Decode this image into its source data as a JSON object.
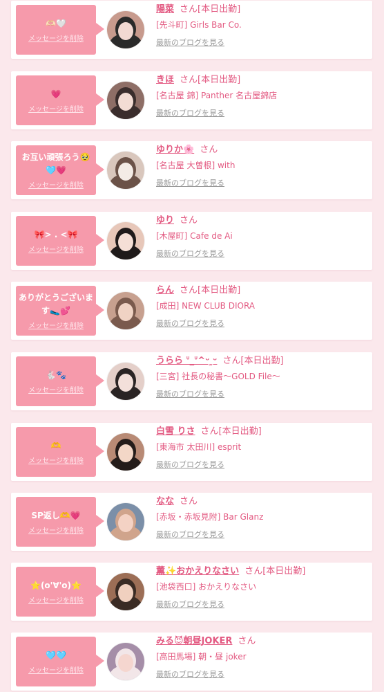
{
  "delete_label": "メッセージを削除",
  "honorific": "さん",
  "blog_label": "最新のブログを見る",
  "badge_label": "[本日出勤]",
  "cards": [
    {
      "message": "🫶🏻🤍",
      "name": "陽菜",
      "on_duty": true,
      "shop": "[先斗町] Girls Bar Co.",
      "avatar_palette": [
        "#2a2a2a",
        "#f2d9d2",
        "#c79a8d"
      ]
    },
    {
      "message": "💗",
      "name": "きほ",
      "on_duty": true,
      "shop": "[名古屋 錦] Panther 名古屋錦店",
      "avatar_palette": [
        "#3a2d2c",
        "#f3dcd4",
        "#8e6e66"
      ]
    },
    {
      "message": "お互い頑張ろう🥹🩵💗",
      "name": "ゆりか🌸",
      "on_duty": false,
      "shop": "[名古屋 大曽根] with",
      "avatar_palette": [
        "#6b5248",
        "#f4ece6",
        "#d9c7bd"
      ]
    },
    {
      "message": "🎀> . <🎀",
      "name": "ゆり",
      "on_duty": false,
      "shop": "[木屋町] Cafe de Ai",
      "avatar_palette": [
        "#1f1a1a",
        "#f5dfd6",
        "#e7c7b9"
      ]
    },
    {
      "message": "ありがとうございます🥿💕",
      "name": "らん",
      "on_duty": true,
      "shop": "[成田] NEW CLUB DIORA",
      "avatar_palette": [
        "#7a5a4d",
        "#f0d3c4",
        "#c7a08f"
      ]
    },
    {
      "message": "🐇🐾",
      "name": "うらら ᐡ_ᐡ^ᵕ ̫ᵕ",
      "on_duty": true,
      "shop": "[三宮] 社長の秘書〜GOLD File〜",
      "avatar_palette": [
        "#2a2424",
        "#f3e0da",
        "#e4cfc9"
      ]
    },
    {
      "message": "🫶",
      "name": "白雪 りさ",
      "on_duty": true,
      "shop": "[東海市 太田川] esprit",
      "avatar_palette": [
        "#241c1a",
        "#f3d7c7",
        "#b88a75"
      ]
    },
    {
      "message": "SP返し🫶💗",
      "name": "なな",
      "on_duty": false,
      "shop": "[赤坂・赤坂見附] Bar Glanz",
      "avatar_palette": [
        "#7b8fa8",
        "#f4d2c4",
        "#d0a48c"
      ]
    },
    {
      "message": "⭐️(o'∀'o)⭐️",
      "name": "薫✨おかえりなさい",
      "on_duty": true,
      "shop": "[池袋西口] おかえりなさい",
      "avatar_palette": [
        "#3a2b24",
        "#f0d0bf",
        "#9c6e56"
      ]
    },
    {
      "message": "🩵🩵",
      "name": "みる😈朝昼JOKER",
      "on_duty": false,
      "shop": "[高田馬場] 朝・昼 joker",
      "avatar_palette": [
        "#f2e6e8",
        "#f5d6cf",
        "#a58ea8"
      ]
    }
  ]
}
